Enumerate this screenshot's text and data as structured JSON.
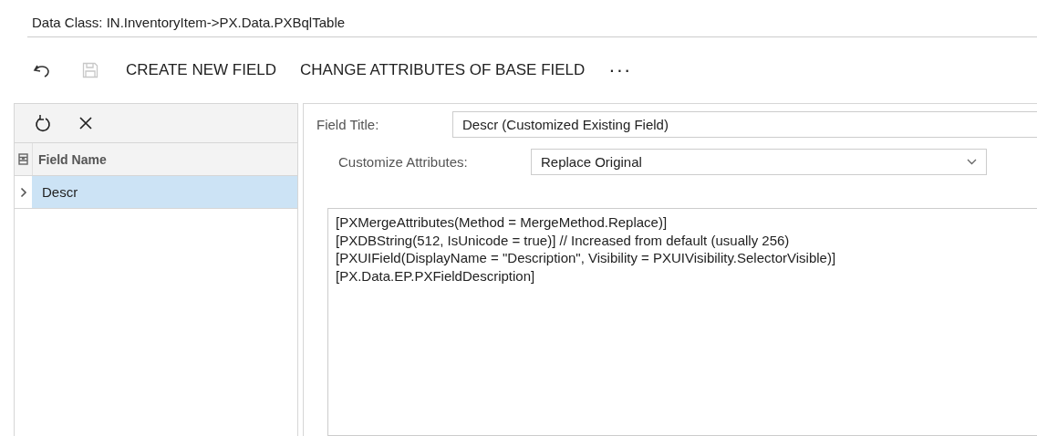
{
  "header": {
    "title": "Data Class: IN.InventoryItem->PX.Data.PXBqlTable"
  },
  "toolbar": [
    {
      "kind": "undo",
      "disabled": false
    },
    {
      "kind": "save",
      "disabled": true
    },
    {
      "kind": "text",
      "label": "CREATE NEW FIELD",
      "disabled": false
    },
    {
      "kind": "text",
      "label": "CHANGE ATTRIBUTES OF BASE FIELD",
      "disabled": false
    },
    {
      "kind": "more",
      "label": "···",
      "disabled": false
    }
  ],
  "grid": {
    "toolbar": [
      {
        "kind": "refresh"
      },
      {
        "kind": "close"
      }
    ],
    "columns": [
      "Field Name"
    ],
    "rows": [
      {
        "cells": [
          "Descr"
        ],
        "selected": true
      }
    ]
  },
  "form": {
    "field_title": {
      "label": "Field Title:",
      "value": "Descr (Customized Existing Field)"
    },
    "customize_attributes": {
      "label": "Customize Attributes:",
      "value": "Replace Original"
    },
    "attributes_text": [
      "[PXMergeAttributes(Method = MergeMethod.Replace)]",
      "[PXDBString(512, IsUnicode = true)] // Increased from default (usually 256)",
      "[PXUIField(DisplayName = \"Description\", Visibility = PXUIVisibility.SelectorVisible)]",
      "[PX.Data.EP.PXFieldDescription]"
    ]
  }
}
